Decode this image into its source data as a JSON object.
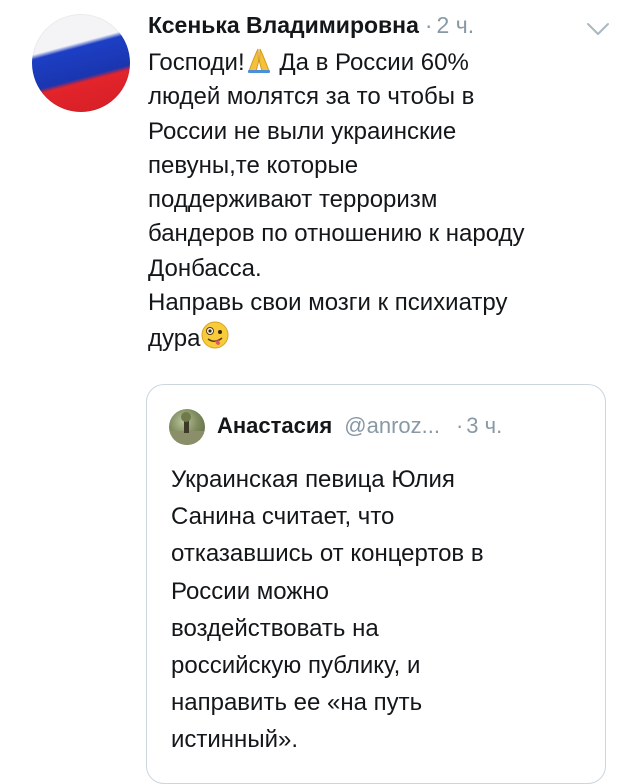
{
  "tweet": {
    "author": "Ксенька Владимировна",
    "separator": "·",
    "time": "2 ч.",
    "lines": [
      "Господи!",
      "Да в России 60%",
      "людей молятся за то чтобы в",
      "России не выли украинские",
      "певуны,те которые",
      "поддерживают терроризм",
      "бандеров по отношению к народу",
      "Донбасса.",
      "Направь свои мозги к психиатру",
      "дура"
    ],
    "emojis": [
      "folded-hands-emoji",
      "zany-face-emoji"
    ]
  },
  "quoted_tweet": {
    "author": "Анастасия",
    "handle": "@anroz...",
    "separator": "·",
    "time": "3 ч.",
    "lines": [
      "Украинская певица Юлия",
      "Санина считает, что",
      "отказавшись от концертов в",
      "России можно",
      "воздействовать на",
      "российскую публику, и",
      "направить ее «на путь",
      "истинный»."
    ]
  },
  "colors": {
    "text": "#14171a",
    "secondary": "#8899a6",
    "border": "#ccd6dd"
  }
}
